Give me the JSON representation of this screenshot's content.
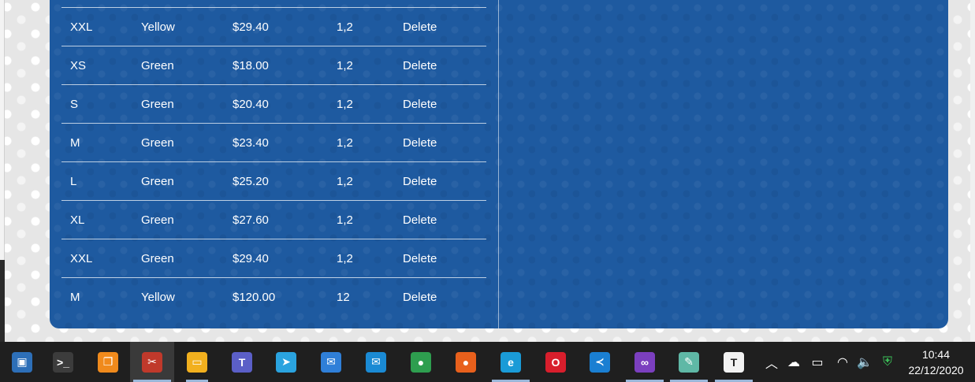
{
  "table": {
    "rows": [
      {
        "size": "XXL",
        "color": "Yellow",
        "price": "$29.40",
        "qty": "1,2",
        "action": "Delete"
      },
      {
        "size": "XS",
        "color": "Green",
        "price": "$18.00",
        "qty": "1,2",
        "action": "Delete"
      },
      {
        "size": "S",
        "color": "Green",
        "price": "$20.40",
        "qty": "1,2",
        "action": "Delete"
      },
      {
        "size": "M",
        "color": "Green",
        "price": "$23.40",
        "qty": "1,2",
        "action": "Delete"
      },
      {
        "size": "L",
        "color": "Green",
        "price": "$25.20",
        "qty": "1,2",
        "action": "Delete"
      },
      {
        "size": "XL",
        "color": "Green",
        "price": "$27.60",
        "qty": "1,2",
        "action": "Delete"
      },
      {
        "size": "XXL",
        "color": "Green",
        "price": "$29.40",
        "qty": "1,2",
        "action": "Delete"
      },
      {
        "size": "M",
        "color": "Yellow",
        "price": "$120.00",
        "qty": "12",
        "action": "Delete"
      }
    ]
  },
  "colors": {
    "panel": "#1e5aa0",
    "taskbar": "#1f1f1f",
    "taskbar_indicator": "#9ab7d9"
  },
  "taskbar": {
    "apps": [
      {
        "icon": "network-computer-icon",
        "glyph": "▣",
        "bg": "#2d6fb8"
      },
      {
        "icon": "terminal-icon",
        "glyph": ">_",
        "bg": "#3c3c3c"
      },
      {
        "icon": "virtual-machine-icon",
        "glyph": "❐",
        "bg": "#f08a1c"
      },
      {
        "icon": "snipping-tool-icon",
        "glyph": "✂",
        "bg": "#c0392b"
      },
      {
        "icon": "file-explorer-icon",
        "glyph": "▭",
        "bg": "#f2b01e"
      },
      {
        "icon": "teams-icon",
        "glyph": "T",
        "bg": "#5b5fc7"
      },
      {
        "icon": "telegram-icon",
        "glyph": "➤",
        "bg": "#2aa3df"
      },
      {
        "icon": "thunderbird-icon",
        "glyph": "✉",
        "bg": "#2f7fd8"
      },
      {
        "icon": "mail-icon",
        "glyph": "✉",
        "bg": "#1a8ad4"
      },
      {
        "icon": "chrome-icon",
        "glyph": "●",
        "bg": "#2e9e4f"
      },
      {
        "icon": "firefox-icon",
        "glyph": "●",
        "bg": "#e8601c"
      },
      {
        "icon": "edge-icon",
        "glyph": "e",
        "bg": "#1a9bd7"
      },
      {
        "icon": "opera-icon",
        "glyph": "O",
        "bg": "#d81e2c"
      },
      {
        "icon": "vscode-icon",
        "glyph": "≺",
        "bg": "#1a7fd2"
      },
      {
        "icon": "visual-studio-icon",
        "glyph": "∞",
        "bg": "#7b3fbf"
      },
      {
        "icon": "notepad-icon",
        "glyph": "✎",
        "bg": "#5fb8a6"
      },
      {
        "icon": "typora-icon",
        "glyph": "T",
        "bg": "#f2f2f2"
      }
    ],
    "tray": [
      {
        "icon": "chevron-up-icon",
        "glyph": "︿"
      },
      {
        "icon": "onedrive-cloud-icon",
        "glyph": "☁"
      },
      {
        "icon": "battery-icon",
        "glyph": "▭"
      },
      {
        "icon": "wifi-icon",
        "glyph": "◠"
      },
      {
        "icon": "volume-icon",
        "glyph": "🔈"
      },
      {
        "icon": "windows-security-icon",
        "glyph": "⛨"
      }
    ],
    "time": "10:44",
    "date": "22/12/2020"
  }
}
